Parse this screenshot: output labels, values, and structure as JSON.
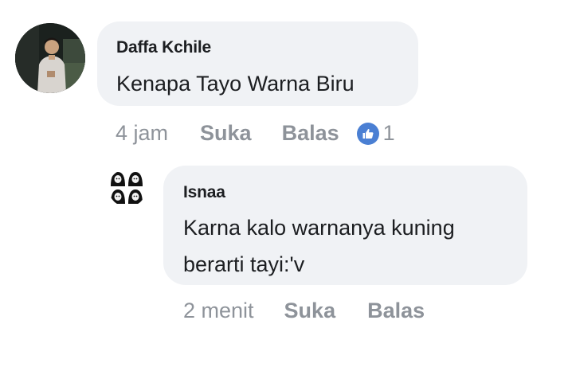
{
  "comment": {
    "author": "Daffa Kchile",
    "text": "Kenapa Tayo Warna Biru",
    "time": "4 jam",
    "like_label": "Suka",
    "reply_label": "Balas",
    "reaction_icon": "thumbs-up-icon",
    "reaction_count": "1",
    "reaction_color": "#4a7fd3"
  },
  "reply": {
    "author": "Isnaa",
    "text_line1": "Karna kalo warnanya kuning",
    "text_line2": "berarti tayi:'v",
    "time": "2 menit",
    "like_label": "Suka",
    "reply_label": "Balas"
  },
  "colors": {
    "bubble": "#f0f2f5",
    "text": "#1c1e21",
    "meta": "#8e939a"
  }
}
